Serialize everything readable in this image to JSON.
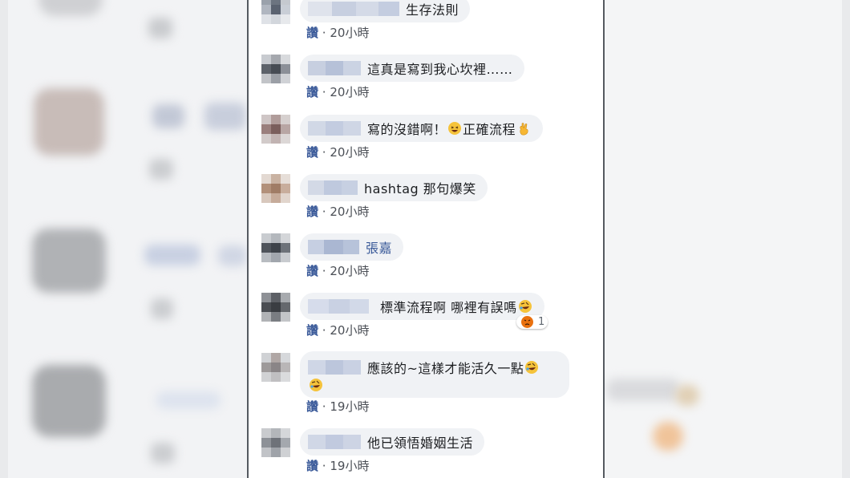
{
  "comments": [
    {
      "text": "生存法則",
      "like": "讚",
      "sep": "·",
      "time": "20小時",
      "name_text": false
    },
    {
      "text": "這真是寫到我心坎裡……",
      "like": "讚",
      "sep": "·",
      "time": "20小時"
    },
    {
      "text": "寫的沒錯啊！",
      "text2": "正確流程",
      "like": "讚",
      "sep": "·",
      "time": "20小時"
    },
    {
      "text": "hashtag 那句爆笑",
      "like": "讚",
      "sep": "·",
      "time": "20小時"
    },
    {
      "text": "張嘉",
      "like": "讚",
      "sep": "·",
      "time": "20小時"
    },
    {
      "text": "標準流程啊 哪裡有誤嗎",
      "like": "讚",
      "sep": "·",
      "time": "20小時",
      "reaction_count": "1"
    },
    {
      "text": "應該的~這樣才能活久一點",
      "like": "讚",
      "sep": "·",
      "time": "19小時"
    },
    {
      "text": "他已領悟婚姻生活",
      "like": "讚",
      "sep": "·",
      "time": "19小時"
    }
  ],
  "colors": {
    "link": "#385898",
    "bubble": "#f0f2f5",
    "text": "#1c1e21",
    "meta": "#4b4f56"
  },
  "icons": {
    "laugh": "laughing-face-icon",
    "ok_hand": "ok-hand-icon",
    "angry": "angry-face-icon",
    "rofl": "rofl-icon"
  }
}
